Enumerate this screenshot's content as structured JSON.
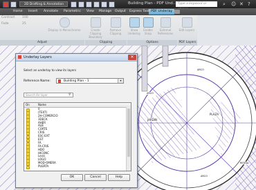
{
  "app": {
    "workspace": "2D Drafting & Annotation",
    "title": "Building Plan - PDF Und...",
    "search_placeholder": "Type a keyword or phrase"
  },
  "ribbon_tabs": [
    "Home",
    "Insert",
    "Annotate",
    "Parametric",
    "View",
    "Manage",
    "Output",
    "Express Tools",
    "PDF Underlay"
  ],
  "ribbon": {
    "adjust": {
      "label": "Adjust",
      "contrast": "Contrast",
      "contrast_val": "100",
      "fade": "Fade",
      "fade_val": "25",
      "monochrome": "Display in Monochrome"
    },
    "clipping": {
      "label": "Clipping",
      "create": "Create Clipping Boundary",
      "remove": "Remove Clipping"
    },
    "options": {
      "label": "Options",
      "show": "Show Underlay",
      "snap": "Enable Snap",
      "external": "External References"
    },
    "pdf_layers": {
      "label": "PDF Layers",
      "edit": "Edit Layers"
    }
  },
  "dialog": {
    "title": "Underlay Layers",
    "instruction": "Select an underlay to view its layers",
    "reference_label": "Reference Name:",
    "reference_value": "Building Plan - 1",
    "search_placeholder": "Search for layer",
    "col_on": "On",
    "col_name": "Name",
    "layers": [
      "0",
      "(TEXT)",
      "2H-COMERCIO",
      "3DECK",
      "AHER",
      "ALB",
      "CORTE",
      "CRIS",
      "ESC-EXT",
      "EST",
      "FA",
      "FA-CRIS",
      "HDO",
      "HICONC",
      "Levis",
      "LOGO",
      "MOD-OMERA",
      "PUERTA"
    ],
    "ok": "OK",
    "cancel": "Cancel",
    "help": "Help"
  },
  "drawing": {
    "labels": [
      "ARCO",
      "ARCO",
      "PLAZA",
      "JARDIN",
      "ARCO",
      "REDNA"
    ]
  },
  "colors": {
    "accent": "#63a8d1",
    "hatch": "#5a3aa8"
  }
}
